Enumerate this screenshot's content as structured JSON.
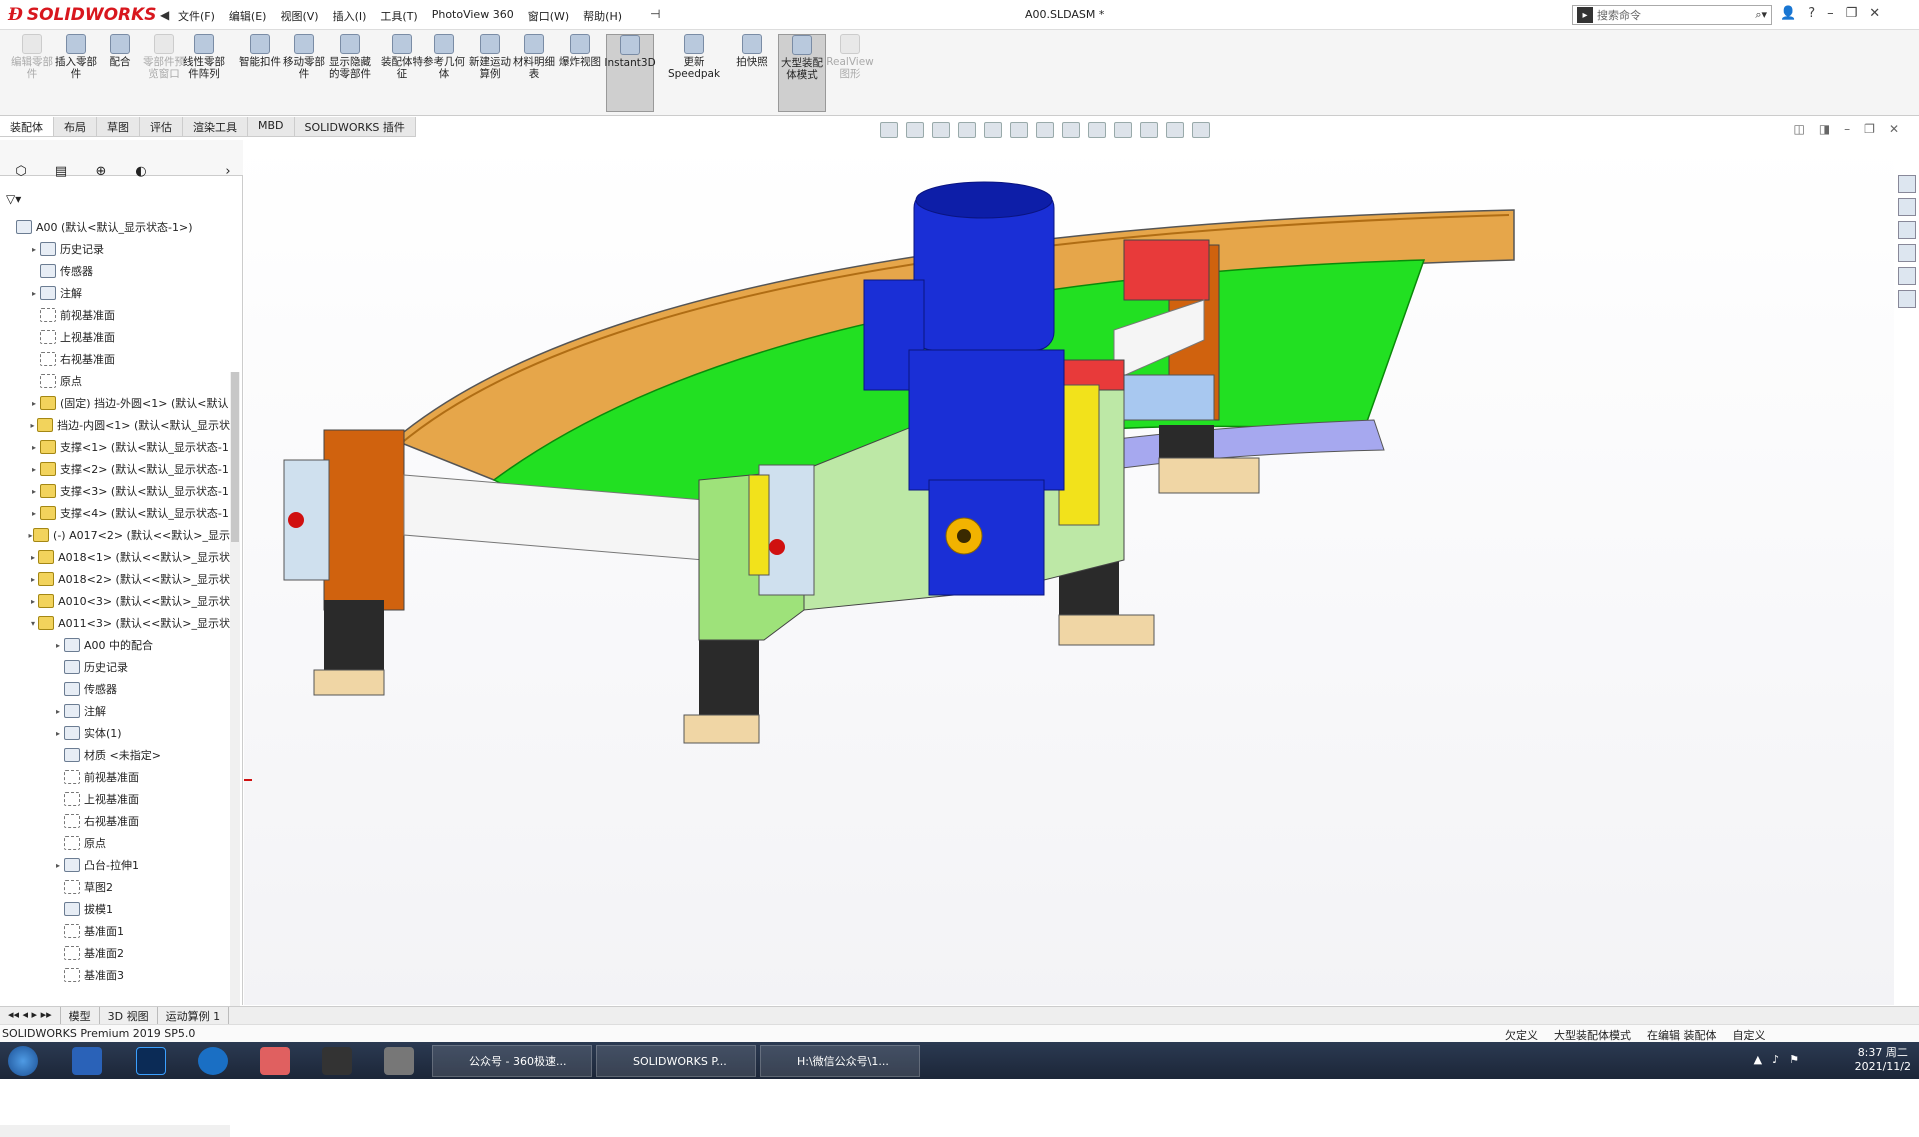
{
  "app": {
    "brand": "SOLIDWORKS",
    "doc_title": "A00.SLDASM *"
  },
  "menu": [
    "文件(F)",
    "编辑(E)",
    "视图(V)",
    "插入(I)",
    "工具(T)",
    "PhotoView 360",
    "窗口(W)",
    "帮助(H)"
  ],
  "search": {
    "placeholder": "搜索命令"
  },
  "ribbon": [
    {
      "label": "编辑零部件",
      "disabled": true
    },
    {
      "label": "插入零部件",
      "disabled": false
    },
    {
      "label": "配合",
      "disabled": false
    },
    {
      "label": "零部件预览窗口",
      "disabled": true
    },
    {
      "label": "线性零部件阵列",
      "disabled": false
    },
    {
      "label": "智能扣件",
      "disabled": false
    },
    {
      "label": "移动零部件",
      "disabled": false
    },
    {
      "label": "显示隐藏的零部件",
      "disabled": false
    },
    {
      "label": "装配体特征",
      "disabled": false
    },
    {
      "label": "参考几何体",
      "disabled": false
    },
    {
      "label": "新建运动算例",
      "disabled": false
    },
    {
      "label": "材料明细表",
      "disabled": false
    },
    {
      "label": "爆炸视图",
      "disabled": false
    },
    {
      "label": "Instant3D",
      "disabled": false,
      "active": true
    },
    {
      "label": "更新Speedpak",
      "disabled": false
    },
    {
      "label": "拍快照",
      "disabled": false
    },
    {
      "label": "大型装配体模式",
      "disabled": false,
      "active": true
    },
    {
      "label": "RealView图形",
      "disabled": true
    }
  ],
  "cmd_tabs": [
    "装配体",
    "布局",
    "草图",
    "评估",
    "渲染工具",
    "MBD",
    "SOLIDWORKS 插件"
  ],
  "tree": [
    {
      "label": "A00 (默认<默认_显示状态-1>)",
      "indent": 0,
      "exp": "",
      "icon": "asm"
    },
    {
      "label": "历史记录",
      "indent": 1,
      "exp": "▸",
      "icon": "asm"
    },
    {
      "label": "传感器",
      "indent": 1,
      "exp": "",
      "icon": "asm"
    },
    {
      "label": "注解",
      "indent": 1,
      "exp": "▸",
      "icon": "asm"
    },
    {
      "label": "前视基准面",
      "indent": 1,
      "exp": "",
      "icon": "plane"
    },
    {
      "label": "上视基准面",
      "indent": 1,
      "exp": "",
      "icon": "plane"
    },
    {
      "label": "右视基准面",
      "indent": 1,
      "exp": "",
      "icon": "plane"
    },
    {
      "label": "原点",
      "indent": 1,
      "exp": "",
      "icon": "plane"
    },
    {
      "label": "(固定) 挡边-外圆<1> (默认<默认",
      "indent": 1,
      "exp": "▸",
      "icon": "part"
    },
    {
      "label": "挡边-内圆<1> (默认<默认_显示状",
      "indent": 1,
      "exp": "▸",
      "icon": "part"
    },
    {
      "label": "支撑<1> (默认<默认_显示状态-1",
      "indent": 1,
      "exp": "▸",
      "icon": "part"
    },
    {
      "label": "支撑<2> (默认<默认_显示状态-1",
      "indent": 1,
      "exp": "▸",
      "icon": "part"
    },
    {
      "label": "支撑<3> (默认<默认_显示状态-1",
      "indent": 1,
      "exp": "▸",
      "icon": "part"
    },
    {
      "label": "支撑<4> (默认<默认_显示状态-1",
      "indent": 1,
      "exp": "▸",
      "icon": "part"
    },
    {
      "label": "(-) A017<2> (默认<<默认>_显示",
      "indent": 1,
      "exp": "▸",
      "icon": "part"
    },
    {
      "label": "A018<1> (默认<<默认>_显示状",
      "indent": 1,
      "exp": "▸",
      "icon": "part"
    },
    {
      "label": "A018<2> (默认<<默认>_显示状",
      "indent": 1,
      "exp": "▸",
      "icon": "part"
    },
    {
      "label": "A010<3> (默认<<默认>_显示状",
      "indent": 1,
      "exp": "▸",
      "icon": "part"
    },
    {
      "label": "A011<3> (默认<<默认>_显示状",
      "indent": 1,
      "exp": "▾",
      "icon": "part"
    },
    {
      "label": "A00 中的配合",
      "indent": 2,
      "exp": "▸",
      "icon": "asm"
    },
    {
      "label": "历史记录",
      "indent": 2,
      "exp": "",
      "icon": "asm"
    },
    {
      "label": "传感器",
      "indent": 2,
      "exp": "",
      "icon": "asm"
    },
    {
      "label": "注解",
      "indent": 2,
      "exp": "▸",
      "icon": "asm"
    },
    {
      "label": "实体(1)",
      "indent": 2,
      "exp": "▸",
      "icon": "asm"
    },
    {
      "label": "材质 <未指定>",
      "indent": 2,
      "exp": "",
      "icon": "asm"
    },
    {
      "label": "前视基准面",
      "indent": 2,
      "exp": "",
      "icon": "plane"
    },
    {
      "label": "上视基准面",
      "indent": 2,
      "exp": "",
      "icon": "plane"
    },
    {
      "label": "右视基准面",
      "indent": 2,
      "exp": "",
      "icon": "plane"
    },
    {
      "label": "原点",
      "indent": 2,
      "exp": "",
      "icon": "plane"
    },
    {
      "label": "凸台-拉伸1",
      "indent": 2,
      "exp": "▸",
      "icon": "asm"
    },
    {
      "label": "草图2",
      "indent": 2,
      "exp": "",
      "icon": "plane"
    },
    {
      "label": "拔模1",
      "indent": 2,
      "exp": "",
      "icon": "asm"
    },
    {
      "label": "基准面1",
      "indent": 2,
      "exp": "",
      "icon": "plane"
    },
    {
      "label": "基准面2",
      "indent": 2,
      "exp": "",
      "icon": "plane"
    },
    {
      "label": "基准面3",
      "indent": 2,
      "exp": "",
      "icon": "plane"
    }
  ],
  "bottom_tabs": [
    "模型",
    "3D 视图",
    "运动算例 1"
  ],
  "status": {
    "product": "SOLIDWORKS Premium 2019 SP5.0",
    "s1": "欠定义",
    "s2": "大型装配体模式",
    "s3": "在编辑 装配体",
    "s4": "自定义"
  },
  "taskbar": {
    "tasks": [
      "公众号 - 360极速...",
      "SOLIDWORKS P...",
      "H:\\微信公众号\\1..."
    ],
    "time": "8:37 周二",
    "date": "2021/11/2"
  },
  "colors": {
    "belt": "#22e022",
    "motor": "#1a2fd6",
    "frame": "#d07a1a",
    "leg": "#2a2a2a",
    "accent": "#d8171e"
  }
}
